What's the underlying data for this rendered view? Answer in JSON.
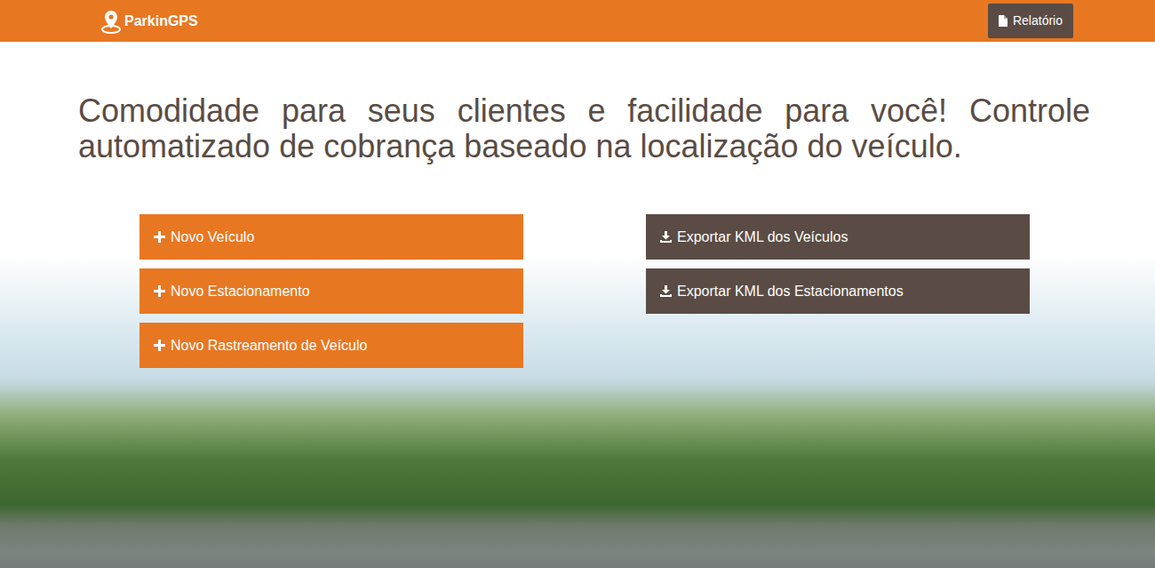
{
  "navbar": {
    "brand": "ParkinGPS",
    "report_button": "Relatório"
  },
  "headline": "Comodidade para seus clientes e facilidade para você! Controle automatizado de cobrança baseado na localização do veículo.",
  "actions": {
    "left": [
      {
        "label": "Novo Veículo",
        "kind": "add"
      },
      {
        "label": "Novo Estacionamento",
        "kind": "add"
      },
      {
        "label": "Novo Rastreamento de Veículo",
        "kind": "add"
      }
    ],
    "right": [
      {
        "label": "Exportar KML dos Veículos",
        "kind": "export"
      },
      {
        "label": "Exportar KML dos Estacionamentos",
        "kind": "export"
      }
    ]
  }
}
